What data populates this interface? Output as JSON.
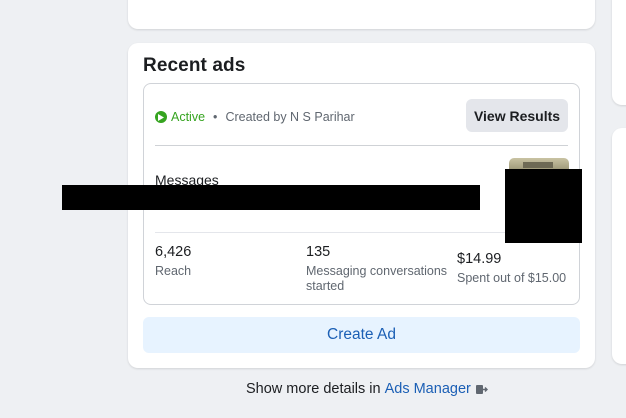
{
  "recent_ads": {
    "title": "Recent ads",
    "ad": {
      "status": "Active",
      "separator": "•",
      "created_by": "Created by N S Parihar",
      "view_results_label": "View Results",
      "name": "Messages",
      "stats": [
        {
          "value": "6,426",
          "label": "Reach"
        },
        {
          "value": "135",
          "label": "Messaging conversations started"
        },
        {
          "value": "$14.99",
          "label": "Spent out of $15.00"
        }
      ]
    },
    "create_ad_label": "Create Ad"
  },
  "footer": {
    "text": "Show more details in",
    "link_label": "Ads Manager",
    "link_icon": "external-link-icon"
  },
  "colors": {
    "accent": "#1b5fb5",
    "active_green": "#36a420",
    "page_bg": "#eef0f3"
  }
}
